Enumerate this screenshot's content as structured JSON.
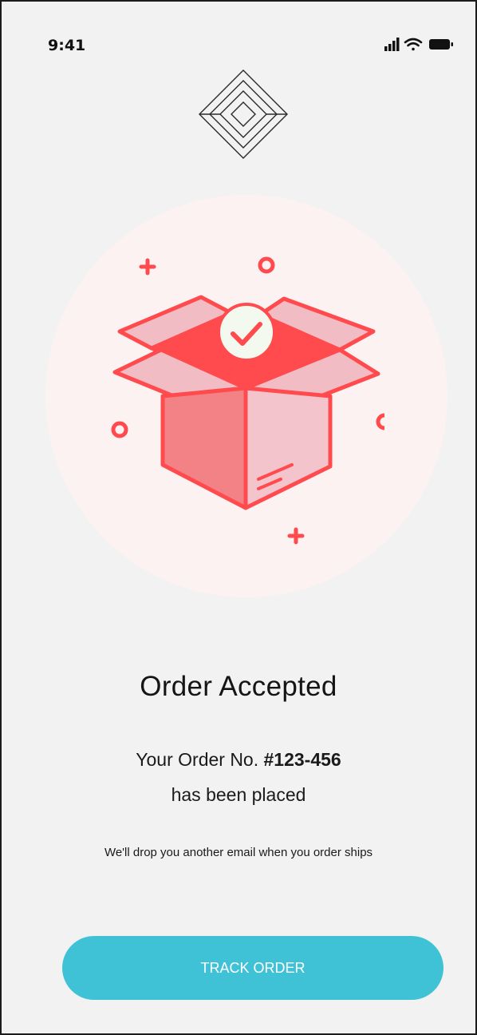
{
  "status_bar": {
    "time": "9:41",
    "icons": [
      "signal-icon",
      "wifi-icon",
      "battery-icon"
    ]
  },
  "logo": {
    "icon": "diamond-logo-icon"
  },
  "hero": {
    "illustration": "open-box-checkmark",
    "colors": {
      "circle": "#fdf2f2",
      "box": "#ff4b4e",
      "box_light": "#f2bcc4",
      "check_bg": "#f4f9ef"
    }
  },
  "content": {
    "title": "Order Accepted",
    "order_prefix": "Your Order No.",
    "order_number": "#123-456",
    "placed_text": "has been placed",
    "notice": "We'll drop you another email when you order ships"
  },
  "actions": {
    "track_label": "TRACK ORDER",
    "track_color": "#40c2d6"
  }
}
